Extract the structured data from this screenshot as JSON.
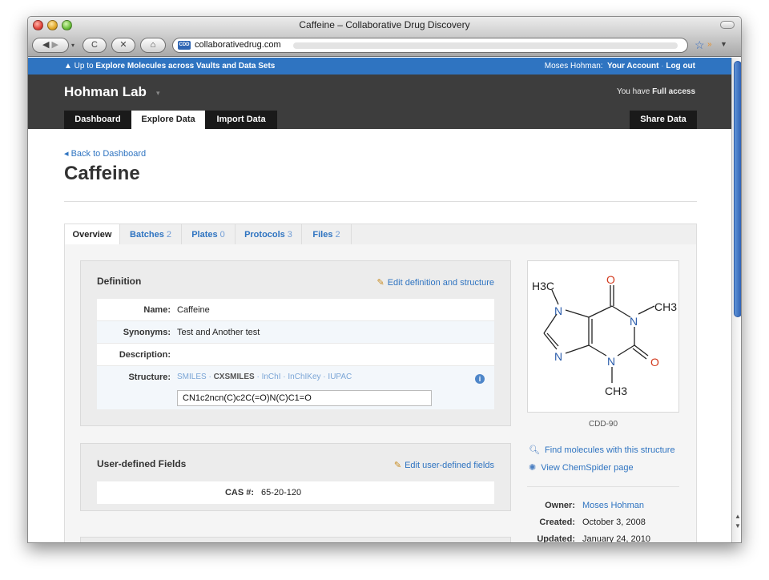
{
  "window": {
    "title": "Caffeine – Collaborative Drug Discovery"
  },
  "browser": {
    "url_host": "collaborativedrug.com",
    "favicon_text": "CDD",
    "icons": [
      "back-icon",
      "forward-icon",
      "reload-icon",
      "stop-icon",
      "home-icon",
      "star-icon",
      "rss-icon"
    ]
  },
  "topbar": {
    "breadcrumb_prefix": "▲ Up to",
    "breadcrumb_link": "Explore Molecules across Vaults and Data Sets",
    "user_name": "Moses Hohman:",
    "account_link": "Your Account",
    "separator": "·",
    "logout_link": "Log out"
  },
  "header": {
    "lab_name": "Hohman Lab",
    "access_prefix": "You have",
    "access_level": "Full access",
    "nav": [
      "Dashboard",
      "Explore Data",
      "Import Data"
    ],
    "share": "Share Data"
  },
  "page": {
    "back_link": "◂ Back to Dashboard",
    "title": "Caffeine"
  },
  "subtabs": [
    {
      "label": "Overview",
      "count": ""
    },
    {
      "label": "Batches",
      "count": "2"
    },
    {
      "label": "Plates",
      "count": "0"
    },
    {
      "label": "Protocols",
      "count": "3"
    },
    {
      "label": "Files",
      "count": "2"
    }
  ],
  "definition": {
    "heading": "Definition",
    "edit_link": "Edit definition and structure",
    "name_label": "Name:",
    "name_value": "Caffeine",
    "synonyms_label": "Synonyms:",
    "synonyms_value": "Test and Another test",
    "description_label": "Description:",
    "description_value": "",
    "structure_label": "Structure:",
    "formats": [
      "SMILES",
      "CXSMILES",
      "InChI",
      "InChIKey",
      "IUPAC"
    ],
    "selected_format": "CXSMILES",
    "smiles_value": "CN1c2ncn(C)c2C(=O)N(C)C1=O"
  },
  "user_fields": {
    "heading": "User-defined Fields",
    "edit_link": "Edit user-defined fields",
    "cas_label": "CAS #:",
    "cas_value": "65-20-120"
  },
  "structure_panel": {
    "caption": "CDD-90",
    "atom_labels": {
      "methyl_top_left": "H3C",
      "methyl_right": "CH3",
      "methyl_bottom": "CH3",
      "oxygen_top": "O",
      "oxygen_right": "O",
      "n1": "N",
      "n3": "N",
      "n7": "N",
      "n9": "N"
    },
    "find_link": "Find molecules with this structure",
    "chemspider_link": "View ChemSpider page"
  },
  "meta": {
    "owner_label": "Owner:",
    "owner_value": "Moses Hohman",
    "created_label": "Created:",
    "created_value": "October 3, 2008",
    "updated_label": "Updated:",
    "updated_value": "January 24, 2010"
  },
  "colors": {
    "accent": "#2f74c1",
    "header_dark": "#3d3d3d",
    "oxygen": "#d23a1e",
    "nitrogen": "#2a5cab"
  }
}
